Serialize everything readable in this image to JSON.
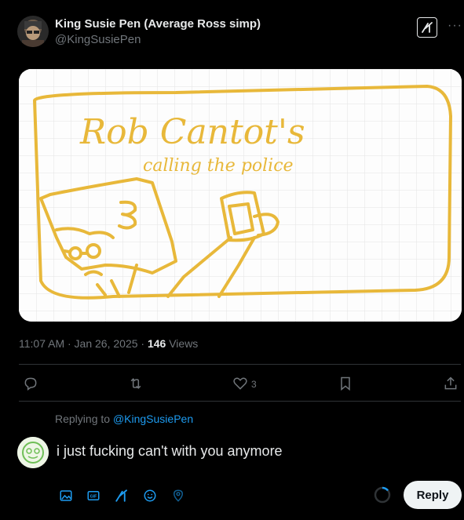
{
  "post": {
    "author_name": "King Susie Pen (Average Ross simp)",
    "author_handle": "@KingSusiePen",
    "timestamp": "11:07 AM · Jan 26, 2025",
    "views_count": "146",
    "views_label": "Views"
  },
  "drawing": {
    "title": "Rob Cantot's",
    "subtitle": "calling the police",
    "ink_color": "#e8b83a"
  },
  "actions": {
    "likes": "3"
  },
  "reply": {
    "replying_label": "Replying to",
    "replying_handle": "@KingSusiePen",
    "text": "i just fucking can't with you anymore",
    "button_label": "Reply",
    "gif_label": "GIF"
  },
  "colors": {
    "accent": "#1d9bf0",
    "background": "#000000",
    "muted": "#71767b"
  }
}
